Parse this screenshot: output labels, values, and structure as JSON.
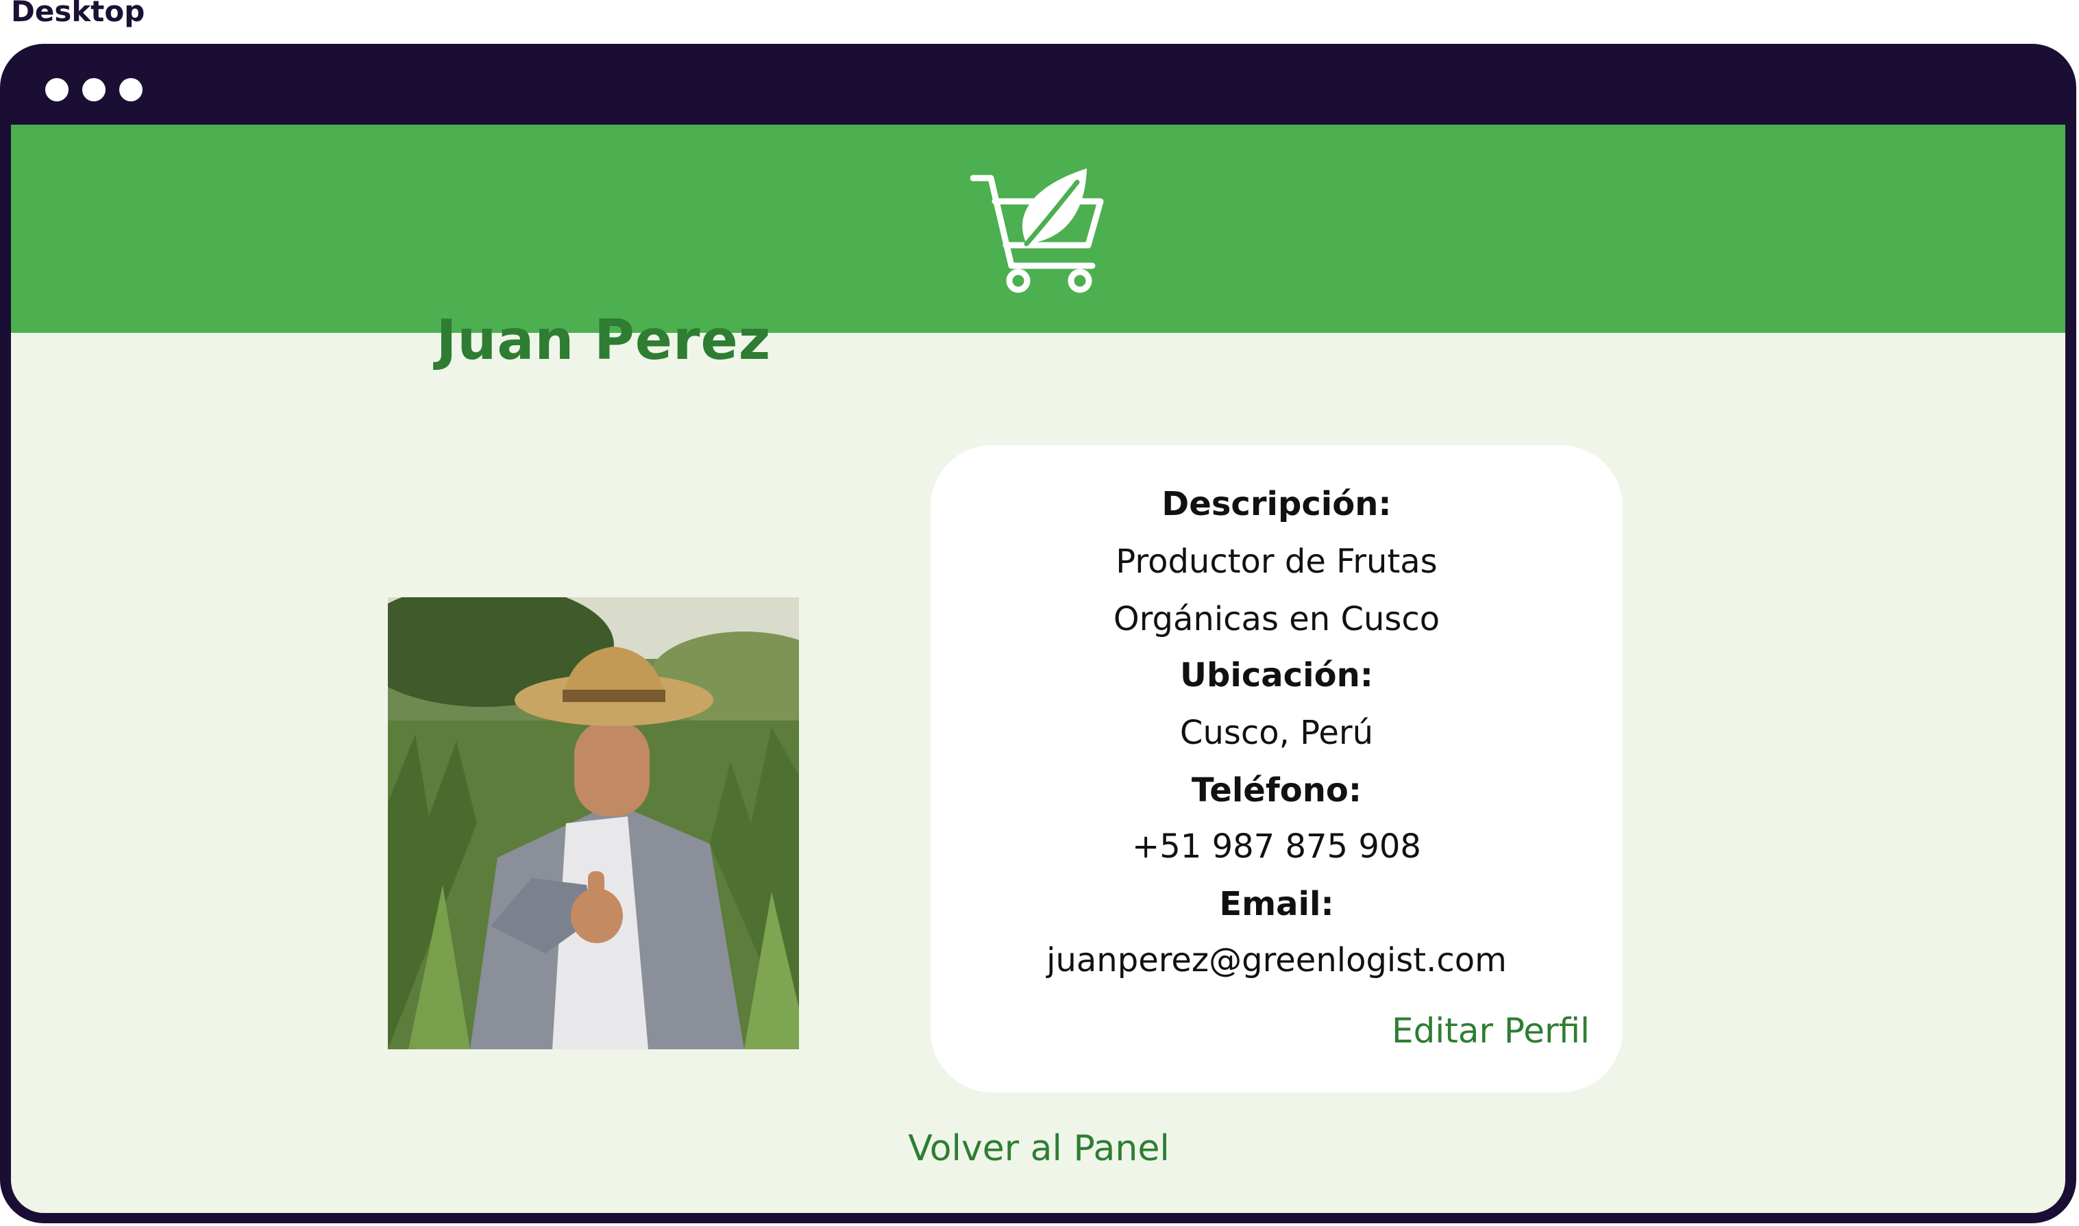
{
  "frame_label": "Desktop",
  "colors": {
    "window_chrome": "#1b0e34",
    "header_green": "#4caf50",
    "page_background": "#eff5e8",
    "accent_text": "#2e7d32",
    "card": "#ffffff"
  },
  "header": {
    "logo_icon": "cart-leaf-icon"
  },
  "profile": {
    "name": "Juan Perez",
    "photo_icon": "farmer-photo"
  },
  "details": {
    "description_label": "Descripción:",
    "description_line1": "Productor de Frutas",
    "description_line2": "Orgánicas en Cusco",
    "location_label": "Ubicación:",
    "location_value": "Cusco, Perú",
    "phone_label": "Teléfono:",
    "phone_value": "+51 987 875 908",
    "email_label": "Email:",
    "email_value": "juanperez@greenlogist.com",
    "edit_link": "Editar Perfil"
  },
  "footer": {
    "back_link": "Volver al Panel"
  }
}
